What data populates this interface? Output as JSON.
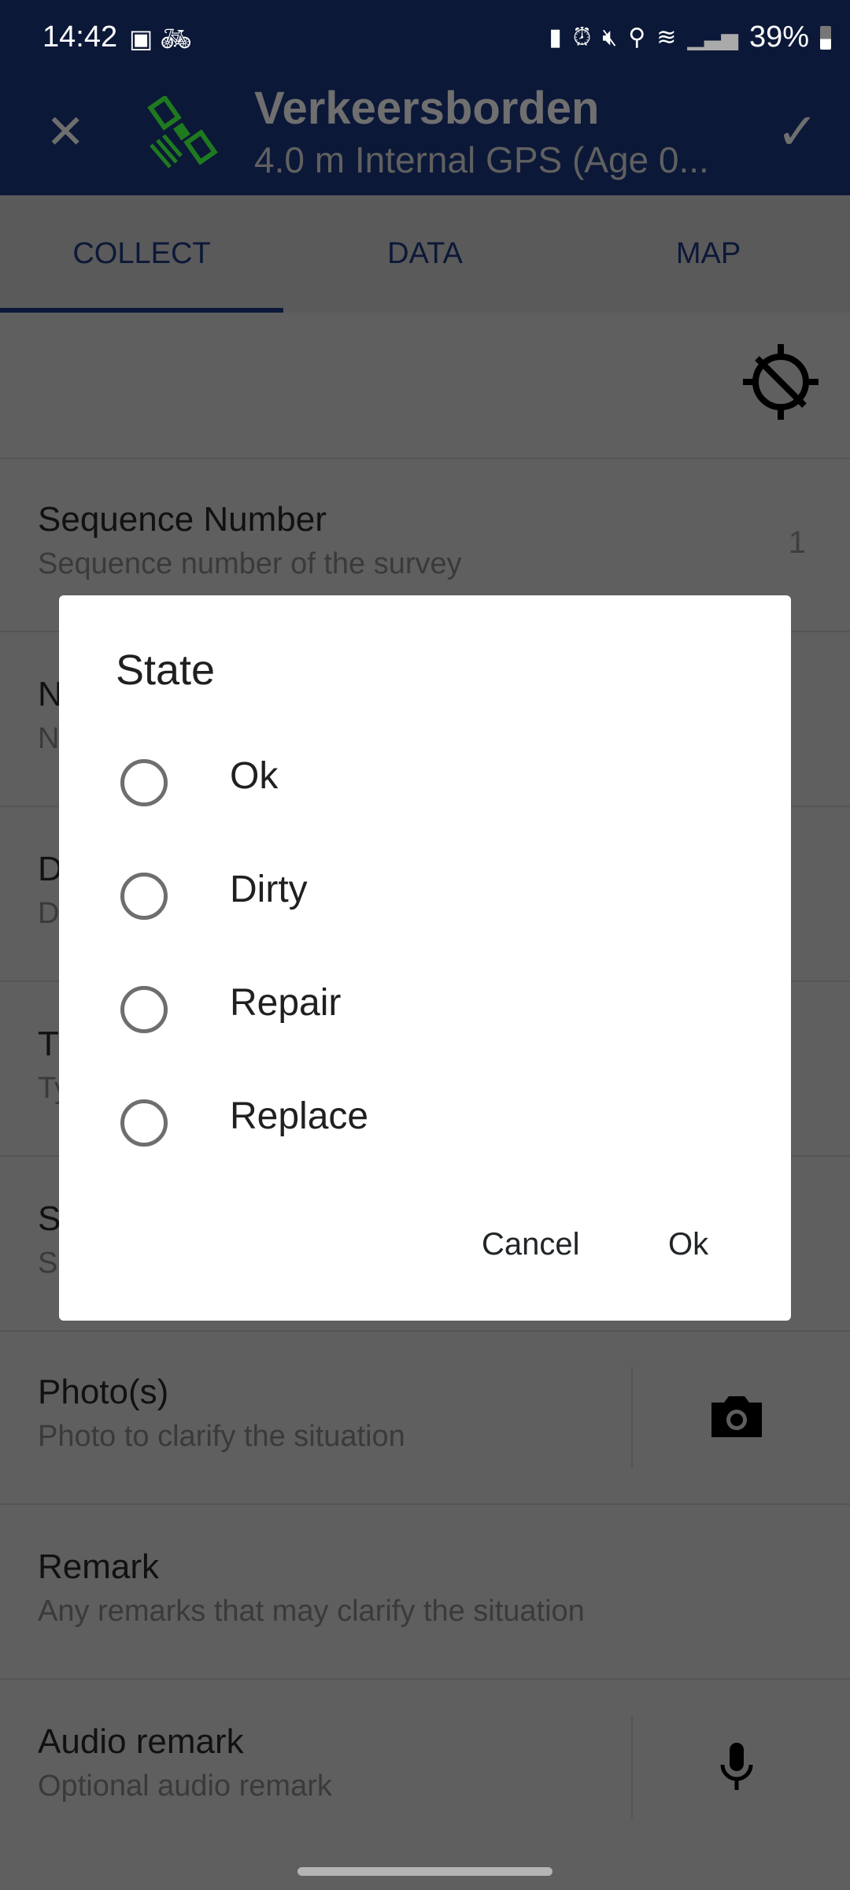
{
  "status_bar": {
    "time": "14:42",
    "left_icons": [
      "image-icon",
      "bicycle-icon"
    ],
    "right_icons": [
      "battery-saver-icon",
      "alarm-icon",
      "mute-icon",
      "location-icon",
      "wifi-icon",
      "signal-icon"
    ],
    "battery": "39%"
  },
  "header": {
    "title": "Verkeersborden",
    "subtitle": "4.0 m Internal GPS (Age 0...",
    "gps_color": "#1f7a1f"
  },
  "tabs": [
    {
      "label": "COLLECT",
      "active": true
    },
    {
      "label": "DATA"
    },
    {
      "label": "MAP"
    }
  ],
  "rows": [
    {
      "label": "Sequence Number",
      "sublabel": "Sequence number of the survey",
      "value": "1"
    },
    {
      "label": "N",
      "sublabel": "N"
    },
    {
      "label": "D",
      "sublabel": "D"
    },
    {
      "label": "T",
      "sublabel": "Ty"
    },
    {
      "label": "S",
      "sublabel": "S"
    },
    {
      "label": "Photo(s)",
      "sublabel": "Photo to clarify the situation",
      "icon": "camera-icon"
    },
    {
      "label": "Remark",
      "sublabel": "Any remarks that may clarify the situation"
    },
    {
      "label": "Audio remark",
      "sublabel": "Optional audio remark",
      "icon": "microphone-icon"
    }
  ],
  "dialog": {
    "title": "State",
    "options": [
      "Ok",
      "Dirty",
      "Repair",
      "Replace"
    ],
    "selected": null,
    "cancel": "Cancel",
    "ok": "Ok"
  }
}
